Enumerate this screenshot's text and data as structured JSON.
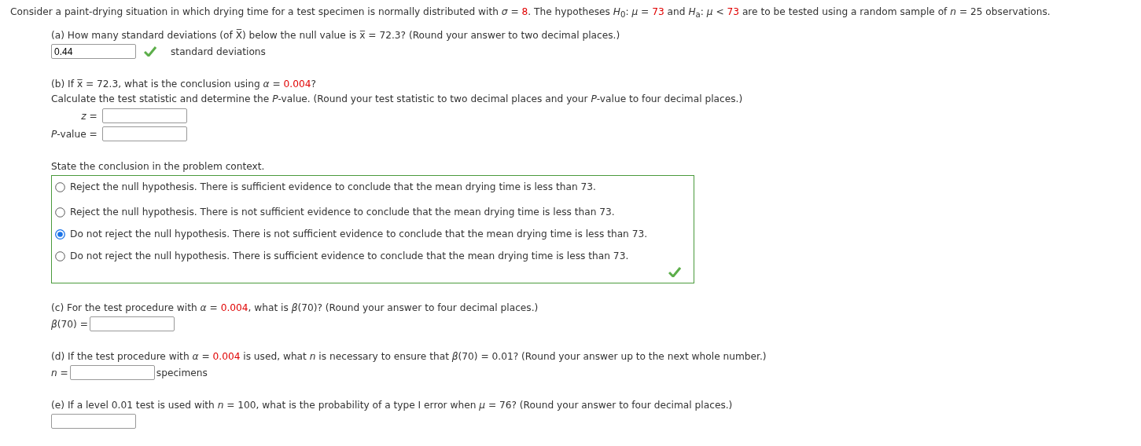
{
  "intro": [
    {
      "kind": "plain",
      "text": "Consider a paint-drying situation in which drying time for a test specimen is normally distributed with *σ* = "
    },
    {
      "kind": "given",
      "text": "8"
    },
    {
      "kind": "plain",
      "text": ". The hypotheses *H*$_{0}$: *μ* = "
    },
    {
      "kind": "given",
      "text": "73"
    },
    {
      "kind": "plain",
      "text": " and *H*$_{a}$: *μ* < "
    },
    {
      "kind": "given",
      "text": "73"
    },
    {
      "kind": "plain",
      "text": " are to be tested using a random sample of *n* = 25 observations."
    }
  ],
  "parts": [
    {
      "question": [
        {
          "kind": "plain",
          "text": "(a) How many standard deviations (of X̅) below the null value is x̅ = 72.3? (Round your answer to two decimal places.)"
        }
      ],
      "fields": [
        {
          "kind": "text",
          "value": "0.44",
          "correct": true,
          "unit": "standard deviations"
        }
      ]
    },
    {
      "question": [
        {
          "kind": "plain",
          "text": "(b) If x̅ = 72.3, what is the conclusion using *α* = "
        },
        {
          "kind": "given",
          "text": "0.004"
        },
        {
          "kind": "plain",
          "text": "?"
        }
      ],
      "instruction": "Calculate the test statistic and determine the *P*-value. (Round your test statistic to two decimal places and your *P*-value to four decimal places.)",
      "fields": [
        {
          "kind": "text",
          "label": "*z* ="
        },
        {
          "kind": "text",
          "label": "*P*-value ="
        }
      ],
      "choice": {
        "prompt": "State the conclusion in the problem context.",
        "correct": true,
        "options": [
          {
            "text": "Reject the null hypothesis. There is sufficient evidence to conclude that the mean drying time is less than 73.",
            "selected": false
          },
          {
            "text": "Reject the null hypothesis. There is not sufficient evidence to conclude that the mean drying time is less than 73.",
            "selected": false
          },
          {
            "text": "Do not reject the null hypothesis. There is not sufficient evidence to conclude that the mean drying time is less than 73.",
            "selected": true
          },
          {
            "text": "Do not reject the null hypothesis. There is sufficient evidence to conclude that the mean drying time is less than 73.",
            "selected": false
          }
        ]
      }
    },
    {
      "question": [
        {
          "kind": "plain",
          "text": "(c) For the test procedure with *α* = "
        },
        {
          "kind": "given",
          "text": "0.004"
        },
        {
          "kind": "plain",
          "text": ", what is *β*(70)? (Round your answer to four decimal places.)"
        }
      ],
      "fields": [
        {
          "kind": "text",
          "label": "*β*(70) ="
        }
      ]
    },
    {
      "question": [
        {
          "kind": "plain",
          "text": "(d) If the test procedure with *α* = "
        },
        {
          "kind": "given",
          "text": "0.004"
        },
        {
          "kind": "plain",
          "text": " is used, what *n* is necessary to ensure that *β*(70) = 0.01? (Round your answer up to the next whole number.)"
        }
      ],
      "fields": [
        {
          "kind": "text",
          "label": "*n* =",
          "unit": "specimens"
        }
      ]
    },
    {
      "question": [
        {
          "kind": "plain",
          "text": "(e) If a level 0.01 test is used with *n* = 100, what is the probability of a type I error when *μ* = 76? (Round your answer to four decimal places.)"
        }
      ],
      "fields": [
        {
          "kind": "text"
        }
      ]
    }
  ]
}
